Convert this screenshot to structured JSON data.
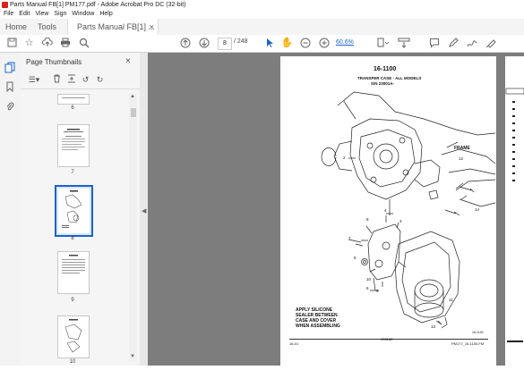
{
  "window": {
    "title": "Parts Manual FB[1] PM177.pdf - Adobe Acrobat Pro DC (32-bit)"
  },
  "menu": [
    "File",
    "Edit",
    "View",
    "Sign",
    "Window",
    "Help"
  ],
  "tabs": {
    "home": "Home",
    "tools": "Tools",
    "document": "Parts Manual FB[1] ...",
    "close": "×"
  },
  "toolbar": {
    "current_page": "8",
    "page_total": "/ 248",
    "zoom": "60.6%"
  },
  "thumbnails": {
    "title": "Page Thumbnails",
    "close": "×",
    "labels": [
      "6",
      "7",
      "8",
      "9",
      "10"
    ],
    "selected": "8"
  },
  "page": {
    "section": "16-1100",
    "heading_line1": "TRANSFER CASE - ALL MODELS",
    "heading_line2": "S/N 23001A-",
    "frame_label": "FRAME",
    "callouts": [
      "1",
      "2",
      "3",
      "4",
      "5",
      "6",
      "7",
      "8",
      "9",
      "10",
      "11",
      "12",
      "13",
      "14"
    ],
    "note_line1": "APPLY SILICONE",
    "note_line2": "SEALER BETWEEN",
    "note_line3": "CASE AND COVER",
    "note_line4": "WHEN ASSEMBLING",
    "fig_ref": "16-1100",
    "footer_left": "16-01",
    "footer_center": "033183",
    "footer_right": "PM177_16-1100.FM"
  },
  "colors": {
    "accent": "#1a64c8",
    "acrobat_red": "#d4231b",
    "canvas_gray": "#7d7d7d",
    "thumb_selected": "#1a64c8"
  }
}
